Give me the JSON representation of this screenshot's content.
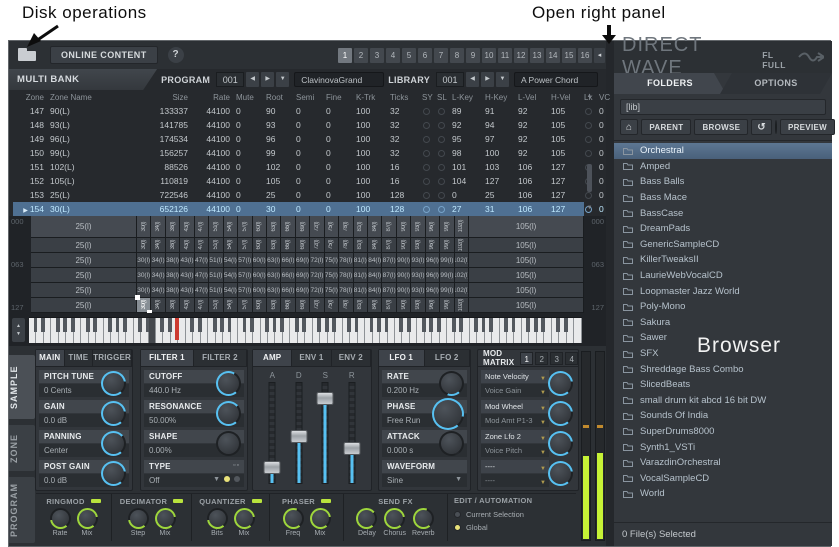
{
  "annotations": {
    "disk_operations": "Disk operations",
    "open_right_panel": "Open right panel",
    "browser": "Browser"
  },
  "toolbar": {
    "online_content": "ONLINE CONTENT",
    "help": "?",
    "bank_tabs": [
      "1",
      "2",
      "3",
      "4",
      "5",
      "6",
      "7",
      "8",
      "9",
      "10",
      "11",
      "12",
      "13",
      "14",
      "15",
      "16"
    ],
    "active_bank_tab": "1",
    "collapse_arrow": "◂"
  },
  "header": {
    "multi_bank": "MULTI BANK",
    "program_label": "PROGRAM",
    "program_number": "001",
    "program_name": "ClavinovaGrand",
    "library_label": "LIBRARY",
    "library_number": "001",
    "library_name": "A Power Chord"
  },
  "zone_table": {
    "columns": [
      "Zone",
      "Zone Name",
      "Size",
      "Rate",
      "Mute",
      "Root",
      "Semi",
      "Fine",
      "K-Trk",
      "Ticks",
      "SY",
      "SL",
      "L-Key",
      "H-Key",
      "L-Vel",
      "H-Vel",
      "Lk",
      "VC"
    ],
    "row_fields": [
      "zone",
      "name",
      "size",
      "rate",
      "mute",
      "root",
      "semi",
      "fine",
      "ktrk",
      "ticks",
      "lkey",
      "hkey",
      "lvel",
      "hvel",
      "vc"
    ],
    "rows": [
      [
        "147",
        "90(L)",
        "133337",
        "44100",
        "0",
        "90",
        "0",
        "0",
        "100",
        "32",
        "89",
        "91",
        "92",
        "105",
        "0"
      ],
      [
        "148",
        "93(L)",
        "141785",
        "44100",
        "0",
        "93",
        "0",
        "0",
        "100",
        "32",
        "92",
        "94",
        "92",
        "105",
        "0"
      ],
      [
        "149",
        "96(L)",
        "174534",
        "44100",
        "0",
        "96",
        "0",
        "0",
        "100",
        "32",
        "95",
        "97",
        "92",
        "105",
        "0"
      ],
      [
        "150",
        "99(L)",
        "156257",
        "44100",
        "0",
        "99",
        "0",
        "0",
        "100",
        "32",
        "98",
        "100",
        "92",
        "105",
        "0"
      ],
      [
        "151",
        "102(L)",
        "88526",
        "44100",
        "0",
        "102",
        "0",
        "0",
        "100",
        "16",
        "101",
        "103",
        "106",
        "127",
        "0"
      ],
      [
        "152",
        "105(L)",
        "110819",
        "44100",
        "0",
        "105",
        "0",
        "0",
        "100",
        "16",
        "104",
        "127",
        "106",
        "127",
        "0"
      ],
      [
        "153",
        "25(L)",
        "722546",
        "44100",
        "0",
        "25",
        "0",
        "0",
        "100",
        "128",
        "0",
        "25",
        "106",
        "127",
        "0"
      ],
      [
        "154",
        "30(L)",
        "652126",
        "44100",
        "0",
        "30",
        "0",
        "0",
        "100",
        "128",
        "27",
        "31",
        "106",
        "127",
        "0"
      ]
    ],
    "selected_zone": "154"
  },
  "zone_map": {
    "velocity_labels": [
      "000",
      "063",
      "127"
    ],
    "left_cell": "25(l)",
    "right_cell": "105(l)",
    "cells": [
      "30(l)",
      "34(l)",
      "38(l)",
      "43(l)",
      "47(l)",
      "51(l)",
      "54(l)",
      "57(l)",
      "60(l)",
      "63(l)",
      "66(l)",
      "69(l)",
      "72(l)",
      "75(l)",
      "78(l)",
      "81(l)",
      "84(l)",
      "87(l)",
      "90(l)",
      "93(l)",
      "96(l)",
      "99(l)",
      "102(l)"
    ],
    "selected_cell": "30(l)"
  },
  "sample_editor": {
    "side_tabs": [
      "SAMPLE",
      "ZONE",
      "PROGRAM"
    ],
    "active_side_tab": "SAMPLE",
    "main_tabs": [
      "MAIN",
      "TIME",
      "TRIGGER"
    ],
    "active_main_tab": "MAIN",
    "main_params": [
      {
        "label": "PITCH TUNE",
        "value": "0 Cents"
      },
      {
        "label": "GAIN",
        "value": "0.0 dB"
      },
      {
        "label": "PANNING",
        "value": "Center"
      },
      {
        "label": "POST GAIN",
        "value": "0.0 dB"
      }
    ],
    "filter_tabs": [
      "FILTER 1",
      "FILTER 2"
    ],
    "active_filter_tab": "FILTER 1",
    "filter_params": [
      {
        "label": "CUTOFF",
        "value": "440.0 Hz"
      },
      {
        "label": "RESONANCE",
        "value": "50.00%"
      },
      {
        "label": "SHAPE",
        "value": "0.00%"
      },
      {
        "label": "TYPE",
        "value": "Off"
      }
    ],
    "amp_tabs": [
      "AMP",
      "ENV 1",
      "ENV 2"
    ],
    "active_amp_tab": "AMP",
    "adsr_labels": [
      "A",
      "D",
      "S",
      "R"
    ],
    "lfo_tabs": [
      "LFO 1",
      "LFO 2"
    ],
    "active_lfo_tab": "LFO 1",
    "lfo_params": [
      {
        "label": "RATE",
        "value": "0.200 Hz"
      },
      {
        "label": "PHASE",
        "value": "Free Run"
      },
      {
        "label": "ATTACK",
        "value": "0.000 s"
      },
      {
        "label": "WAVEFORM",
        "value": "Sine"
      }
    ],
    "mod_matrix": {
      "title": "MOD MATRIX",
      "tabs": [
        "1",
        "2",
        "3",
        "4"
      ],
      "active_tab": "1",
      "slots": [
        {
          "source": "Note Velocity",
          "target": "Voice Gain"
        },
        {
          "source": "Mod Wheel",
          "target": "Mod Amt P1-3"
        },
        {
          "source": "Zone Lfo 2",
          "target": "Voice Pitch"
        },
        {
          "source": "----",
          "target": "----"
        }
      ]
    }
  },
  "fx_row": {
    "sections": [
      {
        "title": "RINGMOD",
        "led": true,
        "knobs": [
          "Rate",
          "Mix"
        ]
      },
      {
        "title": "DECIMATOR",
        "led": true,
        "knobs": [
          "Step",
          "Mix"
        ]
      },
      {
        "title": "QUANTIZER",
        "led": true,
        "knobs": [
          "Bits",
          "Mix"
        ]
      },
      {
        "title": "PHASER",
        "led": true,
        "knobs": [
          "Freq",
          "Mix"
        ]
      },
      {
        "title": "SEND FX",
        "led": false,
        "knobs": [
          "Delay",
          "Chorus",
          "Reverb"
        ]
      }
    ],
    "edit_automation": {
      "title": "EDIT / AUTOMATION",
      "options": [
        "Current Selection",
        "Global"
      ],
      "selected": "Global"
    }
  },
  "browser": {
    "title": "DIRECT WAVE",
    "subtitle": "FL FULL",
    "tabs": [
      "FOLDERS",
      "OPTIONS"
    ],
    "active_tab": "FOLDERS",
    "path": "[lib]",
    "parent_button": "PARENT",
    "browse_button": "BROWSE",
    "preview_button": "PREVIEW",
    "folders": [
      "Orchestral",
      "Amped",
      "Bass Balls",
      "Bass Mace",
      "BassCase",
      "DreamPads",
      "GenericSampleCD",
      "KillerTweaksII",
      "LaurieWebVocalCD",
      "Loopmaster Jazz World",
      "Poly-Mono",
      "Sakura",
      "Sawer",
      "SFX",
      "Shreddage Bass Combo",
      "SlicedBeats",
      "small drum kit abcd 16 bit DW",
      "Sounds Of India",
      "SuperDrums8000",
      "Synth1_VSTi",
      "VarazdinOrchestral",
      "VocalSampleCD",
      "World"
    ],
    "selected_folder": "Orchestral",
    "status": "0 File(s) Selected"
  }
}
